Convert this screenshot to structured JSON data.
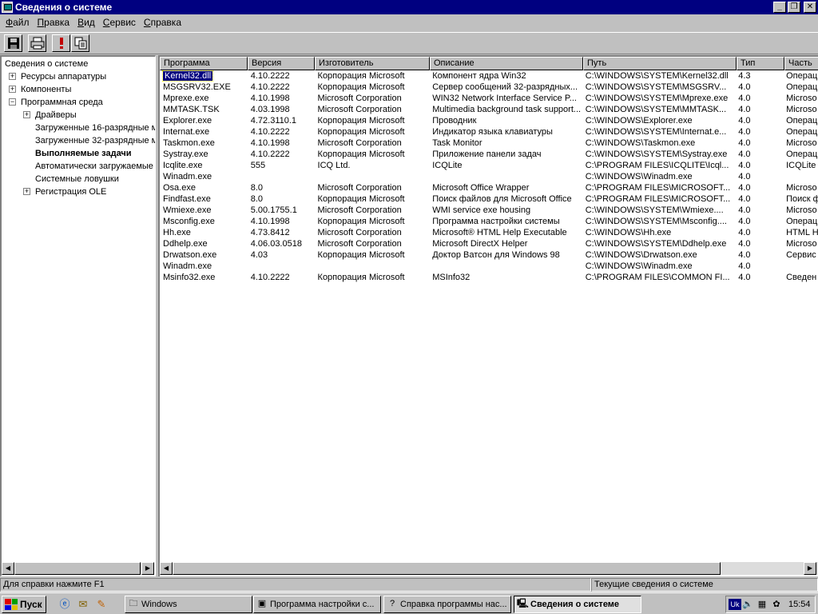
{
  "window": {
    "title": "Сведения о системе"
  },
  "menu": [
    {
      "label": "Файл",
      "u": "Ф",
      "rest": "айл"
    },
    {
      "label": "Правка",
      "u": "П",
      "rest": "равка"
    },
    {
      "label": "Вид",
      "u": "В",
      "rest": "ид"
    },
    {
      "label": "Сервис",
      "u": "С",
      "rest": "ервис"
    },
    {
      "label": "Справка",
      "u": "С",
      "rest": "правка"
    }
  ],
  "toolbar": [
    "save-icon",
    "print-icon",
    "alert-icon",
    "copy-icon"
  ],
  "tree": [
    {
      "label": "Сведения о системе",
      "level": 0,
      "exp": ""
    },
    {
      "label": "Ресурсы аппаратуры",
      "level": 1,
      "exp": "+"
    },
    {
      "label": "Компоненты",
      "level": 1,
      "exp": "+"
    },
    {
      "label": "Программная среда",
      "level": 1,
      "exp": "−"
    },
    {
      "label": "Драйверы",
      "level": 2,
      "exp": "+"
    },
    {
      "label": "Загруженные 16-разрядные м",
      "level": 2,
      "exp": ""
    },
    {
      "label": "Загруженные 32-разрядные м",
      "level": 2,
      "exp": ""
    },
    {
      "label": "Выполняемые задачи",
      "level": 2,
      "exp": "",
      "bold": true
    },
    {
      "label": "Автоматически загружаемые",
      "level": 2,
      "exp": ""
    },
    {
      "label": "Системные ловушки",
      "level": 2,
      "exp": ""
    },
    {
      "label": "Регистрация OLE",
      "level": 2,
      "exp": "+"
    }
  ],
  "table": {
    "columns": [
      "Программа",
      "Версия",
      "Изготовитель",
      "Описание",
      "Путь",
      "Тип",
      "Часть"
    ],
    "rows": [
      [
        "Kernel32.dll",
        "4.10.2222",
        "Корпорация Microsoft",
        "Компонент ядра Win32",
        "C:\\WINDOWS\\SYSTEM\\Kernel32.dll",
        "4.3",
        "Операц"
      ],
      [
        "MSGSRV32.EXE",
        "4.10.2222",
        "Корпорация Microsoft",
        "Сервер сообщений 32-разрядных...",
        "C:\\WINDOWS\\SYSTEM\\MSGSRV...",
        "4.0",
        "Операц"
      ],
      [
        "Mprexe.exe",
        "4.10.1998",
        "Microsoft Corporation",
        "WIN32 Network Interface Service P...",
        "C:\\WINDOWS\\SYSTEM\\Mprexe.exe",
        "4.0",
        "Microso"
      ],
      [
        "MMTASK.TSK",
        "4.03.1998",
        "Microsoft Corporation",
        "Multimedia background task support...",
        "C:\\WINDOWS\\SYSTEM\\MMTASK...",
        "4.0",
        "Microso"
      ],
      [
        "Explorer.exe",
        "4.72.3110.1",
        "Корпорация Microsoft",
        "Проводник",
        "C:\\WINDOWS\\Explorer.exe",
        "4.0",
        "Операц"
      ],
      [
        "Internat.exe",
        "4.10.2222",
        "Корпорация Microsoft",
        "Индикатор языка клавиатуры",
        "C:\\WINDOWS\\SYSTEM\\Internat.e...",
        "4.0",
        "Операц"
      ],
      [
        "Taskmon.exe",
        "4.10.1998",
        "Microsoft Corporation",
        "Task Monitor",
        "C:\\WINDOWS\\Taskmon.exe",
        "4.0",
        "Microso"
      ],
      [
        "Systray.exe",
        "4.10.2222",
        "Корпорация Microsoft",
        "Приложение панели задач",
        "C:\\WINDOWS\\SYSTEM\\Systray.exe",
        "4.0",
        "Операц"
      ],
      [
        "Icqlite.exe",
        "555",
        "ICQ Ltd.",
        "ICQLite",
        "C:\\PROGRAM FILES\\ICQLITE\\Icql...",
        "4.0",
        "ICQLite"
      ],
      [
        "Winadm.exe",
        "",
        "",
        "",
        "C:\\WINDOWS\\Winadm.exe",
        "4.0",
        ""
      ],
      [
        "Osa.exe",
        "8.0",
        "Microsoft Corporation",
        "Microsoft Office Wrapper",
        "C:\\PROGRAM FILES\\MICROSOFT...",
        "4.0",
        "Microso"
      ],
      [
        "Findfast.exe",
        "8.0",
        "Корпорация Microsoft",
        "Поиск файлов для Microsoft Office",
        "C:\\PROGRAM FILES\\MICROSOFT...",
        "4.0",
        "Поиск ф"
      ],
      [
        "Wmiexe.exe",
        "5.00.1755.1",
        "Microsoft Corporation",
        "WMI service exe housing",
        "C:\\WINDOWS\\SYSTEM\\Wmiexe....",
        "4.0",
        "Microso"
      ],
      [
        "Msconfig.exe",
        "4.10.1998",
        "Корпорация Microsoft",
        "Программа настройки системы",
        "C:\\WINDOWS\\SYSTEM\\Msconfig....",
        "4.0",
        "Операц"
      ],
      [
        "Hh.exe",
        "4.73.8412",
        "Microsoft Corporation",
        "Microsoft® HTML Help Executable",
        "C:\\WINDOWS\\Hh.exe",
        "4.0",
        "HTML H"
      ],
      [
        "Ddhelp.exe",
        "4.06.03.0518",
        "Microsoft Corporation",
        "Microsoft DirectX Helper",
        "C:\\WINDOWS\\SYSTEM\\Ddhelp.exe",
        "4.0",
        "Microso"
      ],
      [
        "Drwatson.exe",
        "4.03",
        "Корпорация Microsoft",
        "Доктор Ватсон для Windows 98",
        "C:\\WINDOWS\\Drwatson.exe",
        "4.0",
        "Сервис"
      ],
      [
        "Winadm.exe",
        "",
        "",
        "",
        "C:\\WINDOWS\\Winadm.exe",
        "4.0",
        ""
      ],
      [
        "Msinfo32.exe",
        "4.10.2222",
        "Корпорация Microsoft",
        "MSInfo32",
        "C:\\PROGRAM FILES\\COMMON FI...",
        "4.0",
        "Сведен"
      ]
    ]
  },
  "status": {
    "left": "Для справки нажмите F1",
    "right": "Текущие сведения о системе"
  },
  "taskbar": {
    "start": "Пуск",
    "quicklaunch": [
      "ie-icon",
      "outlook-icon",
      "channels-icon"
    ],
    "tasks": [
      {
        "label": "Windows",
        "icon": "folder-icon",
        "active": false
      },
      {
        "label": "Программа настройки с...",
        "icon": "app-icon",
        "active": false
      },
      {
        "label": "Справка программы нас...",
        "icon": "help-icon",
        "active": false
      },
      {
        "label": "Сведения о системе",
        "icon": "sysinfo-icon",
        "active": true
      }
    ],
    "lang": "Uk",
    "clock": "15:54"
  }
}
